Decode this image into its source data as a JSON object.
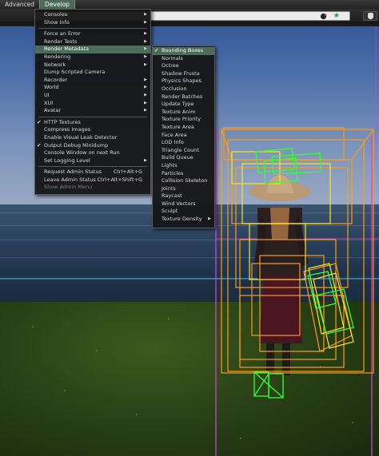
{
  "menubar": {
    "items": [
      {
        "label": "Advanced",
        "active": false
      },
      {
        "label": "Develop",
        "active": true
      }
    ]
  },
  "navbar": {
    "location_value": "",
    "icons": [
      "record-icon",
      "star-icon",
      "avatar-icon"
    ]
  },
  "develop_menu": {
    "items": [
      {
        "label": "Consoles",
        "submenu": true
      },
      {
        "label": "Show Info",
        "submenu": true
      },
      {
        "separator": true
      },
      {
        "label": "Force an Error",
        "submenu": true
      },
      {
        "label": "Render Tests",
        "submenu": true
      },
      {
        "label": "Render Metadata",
        "submenu": true,
        "highlight": true
      },
      {
        "label": "Rendering",
        "submenu": true
      },
      {
        "label": "Network",
        "submenu": true
      },
      {
        "label": "Dump Scripted Camera"
      },
      {
        "label": "Recorder",
        "submenu": true
      },
      {
        "label": "World",
        "submenu": true
      },
      {
        "label": "UI",
        "submenu": true
      },
      {
        "label": "XUI",
        "submenu": true
      },
      {
        "label": "Avatar",
        "submenu": true
      },
      {
        "separator": true
      },
      {
        "label": "HTTP Textures",
        "checked": true
      },
      {
        "label": "Compress Images"
      },
      {
        "label": "Enable Visual Leak Detector"
      },
      {
        "label": "Output Debug Minidump",
        "checked": true
      },
      {
        "label": "Console Window on next Run"
      },
      {
        "label": "Set Logging Level",
        "submenu": true
      },
      {
        "separator": true
      },
      {
        "label": "Request Admin Status",
        "shortcut": "Ctrl+Alt+G"
      },
      {
        "label": "Leave Admin Status",
        "shortcut": "Ctrl+Alt+Shift+G"
      },
      {
        "label": "Show Admin Menu",
        "disabled": true
      }
    ]
  },
  "render_metadata_menu": {
    "items": [
      {
        "label": "Bounding Boxes",
        "checked": true,
        "highlight": true
      },
      {
        "label": "Normals"
      },
      {
        "label": "Octree"
      },
      {
        "label": "Shadow Frusta"
      },
      {
        "label": "Physics Shapes"
      },
      {
        "label": "Occlusion"
      },
      {
        "label": "Render Batches"
      },
      {
        "label": "Update Type"
      },
      {
        "label": "Texture Anim"
      },
      {
        "label": "Texture Priority"
      },
      {
        "label": "Texture Area"
      },
      {
        "label": "Face Area"
      },
      {
        "label": "LOD Info"
      },
      {
        "label": "Triangle Count"
      },
      {
        "label": "Build Queue"
      },
      {
        "label": "Lights"
      },
      {
        "label": "Particles"
      },
      {
        "label": "Collision Skeleton"
      },
      {
        "label": "Joints"
      },
      {
        "label": "Raycast"
      },
      {
        "label": "Wind Vectors"
      },
      {
        "label": "Sculpt"
      },
      {
        "label": "Texture Density",
        "submenu": true
      }
    ]
  },
  "colors": {
    "menu_highlight": "#4d6b5a",
    "bbox_orange": "#ff9a1a",
    "bbox_green": "#33ff33",
    "bbox_yellow": "#ffe61a",
    "magenta_line": "#e040e0",
    "cyan_line": "#30b8d8"
  }
}
